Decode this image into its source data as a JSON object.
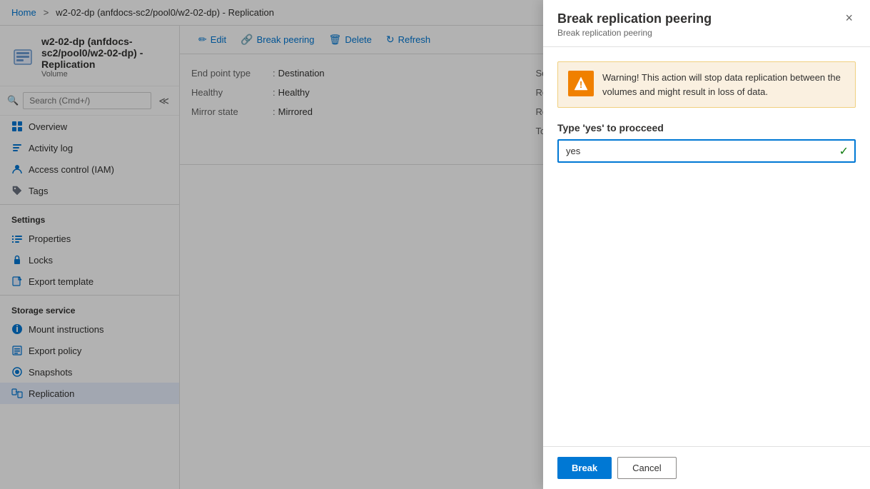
{
  "breadcrumb": {
    "home": "Home",
    "separator1": ">",
    "page": "w2-02-dp (anfdocs-sc2/pool0/w2-02-dp) - Replication"
  },
  "resource": {
    "title": "w2-02-dp (anfdocs-sc2/pool0/w2-02-dp) - Replication",
    "subtitle": "Volume"
  },
  "search": {
    "placeholder": "Search (Cmd+/)"
  },
  "nav": {
    "overview": "Overview",
    "activity_log": "Activity log",
    "access_control": "Access control (IAM)",
    "tags": "Tags",
    "settings_label": "Settings",
    "properties": "Properties",
    "locks": "Locks",
    "export_template": "Export template",
    "storage_service_label": "Storage service",
    "mount_instructions": "Mount instructions",
    "export_policy": "Export policy",
    "snapshots": "Snapshots",
    "replication": "Replication"
  },
  "toolbar": {
    "edit": "Edit",
    "break_peering": "Break peering",
    "delete": "Delete",
    "refresh": "Refresh"
  },
  "table": {
    "rows": [
      {
        "label": "End point type",
        "value": "Destination"
      },
      {
        "label": "Healthy",
        "value": "Healthy"
      },
      {
        "label": "Mirror state",
        "value": "Mirrored"
      }
    ],
    "rows_right": [
      {
        "label": "Sou"
      },
      {
        "label": "Rela"
      },
      {
        "label": "Rep"
      },
      {
        "label": "Tota"
      }
    ]
  },
  "panel": {
    "title": "Break replication peering",
    "subtitle": "Break replication peering",
    "close_label": "×",
    "warning_text": "Warning! This action will stop data replication between the volumes and might result in loss of data.",
    "confirm_label": "Type 'yes' to procceed",
    "confirm_value": "yes",
    "break_button": "Break",
    "cancel_button": "Cancel"
  }
}
